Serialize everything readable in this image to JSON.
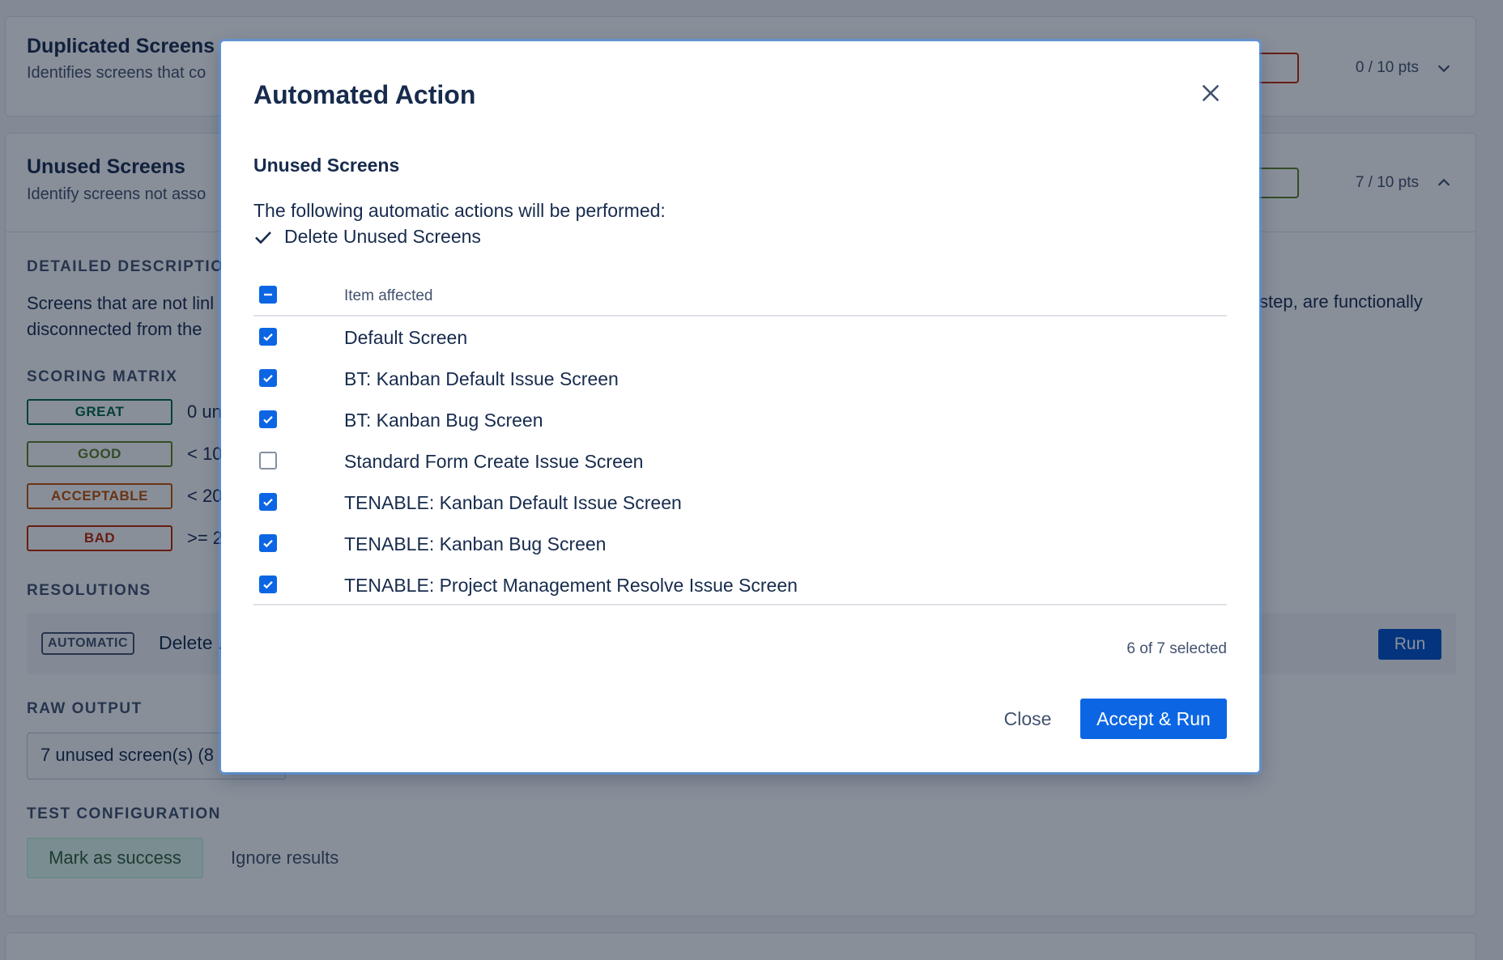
{
  "background": {
    "dup_card": {
      "title": "Duplicated Screens",
      "subtitle": "Identifies screens that co",
      "points": "0 / 10 pts"
    },
    "unused_card": {
      "title": "Unused Screens",
      "subtitle": "Identify screens not asso",
      "points": "7 / 10 pts",
      "detailed_label": "DETAILED DESCRIPTIO",
      "desc_line1": "Screens that are not linl",
      "desc_line2": "disconnected from the",
      "desc_right": "step, are functionally",
      "scoring_label": "SCORING MATRIX",
      "scores": [
        {
          "badge": "GREAT",
          "text": "0 un"
        },
        {
          "badge": "GOOD",
          "text": "< 10"
        },
        {
          "badge": "ACCEPTABLE",
          "text": "< 20"
        },
        {
          "badge": "BAD",
          "text": ">= 2"
        }
      ],
      "resolutions_label": "RESOLUTIONS",
      "resolution_tag": "AUTOMATIC",
      "resolution_text": "Delete .",
      "run_label": "Run",
      "raw_label": "RAW OUTPUT",
      "raw_value": "7 unused screen(s) (8",
      "test_label": "TEST CONFIGURATION",
      "mark_success": "Mark as success",
      "ignore_results": "Ignore results"
    }
  },
  "modal": {
    "title": "Automated Action",
    "subtitle": "Unused Screens",
    "intro": "The following automatic actions will be performed:",
    "action": "Delete Unused Screens",
    "column_header": "Item affected",
    "items": [
      {
        "label": "Default Screen",
        "checked": true
      },
      {
        "label": "BT: Kanban Default Issue Screen",
        "checked": true
      },
      {
        "label": "BT: Kanban Bug Screen",
        "checked": true
      },
      {
        "label": "Standard Form Create Issue Screen",
        "checked": false
      },
      {
        "label": "TENABLE: Kanban Default Issue Screen",
        "checked": true
      },
      {
        "label": "TENABLE: Kanban Bug Screen",
        "checked": true
      },
      {
        "label": "TENABLE: Project Management Resolve Issue Screen",
        "checked": true
      }
    ],
    "selected_count": "6 of 7 selected",
    "close_label": "Close",
    "accept_label": "Accept & Run"
  }
}
